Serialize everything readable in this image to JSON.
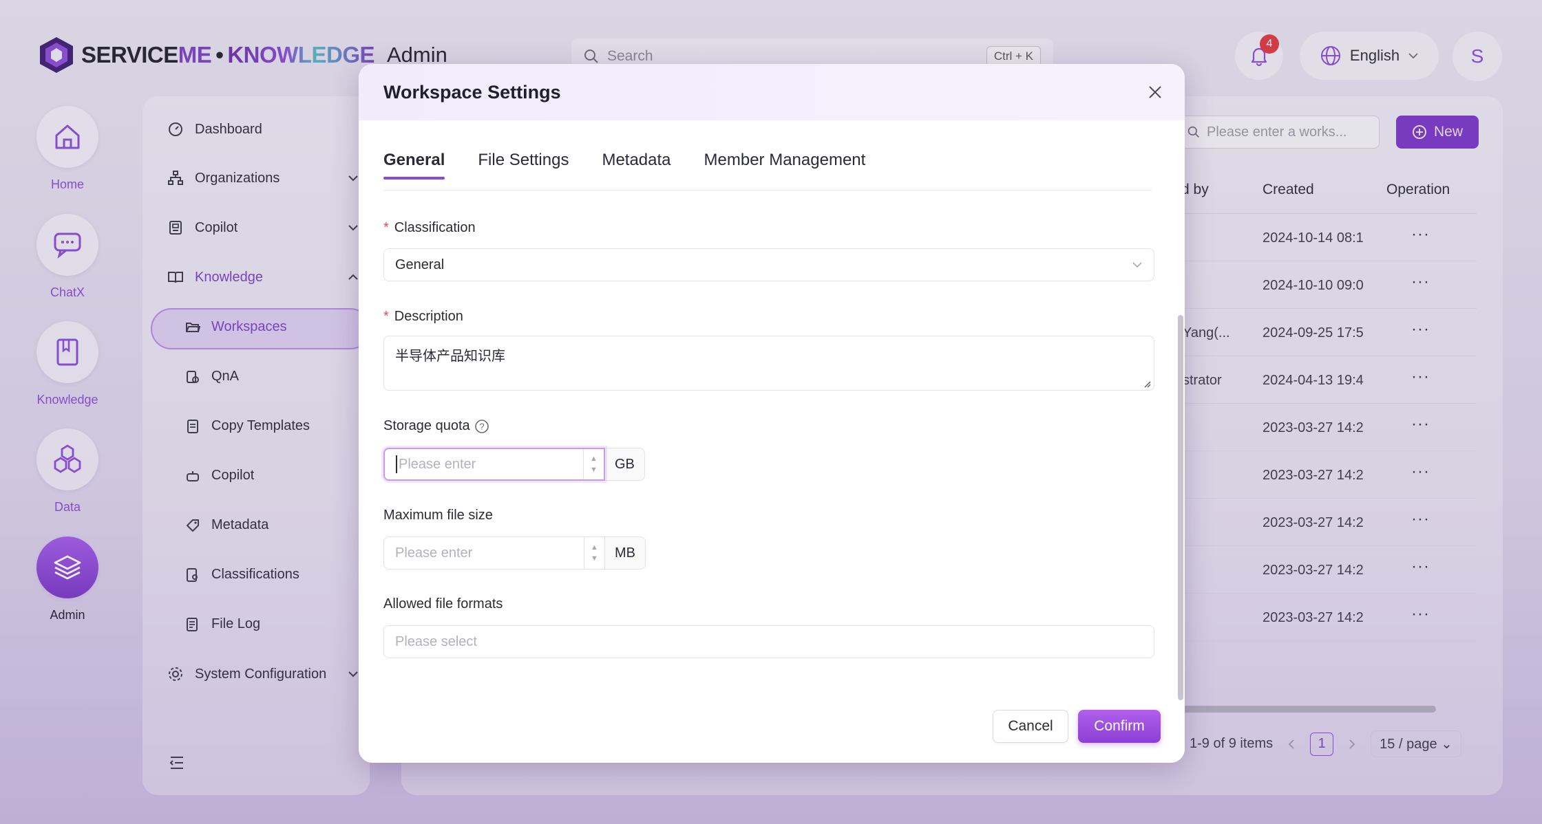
{
  "header": {
    "logo_brand_a": "SERVICE",
    "logo_brand_b": "ME",
    "logo_sep": "•",
    "logo_product": "KNOWLEDGE",
    "page_title": "Admin",
    "search_placeholder": "Search",
    "search_shortcut": "Ctrl + K",
    "notification_count": "4",
    "language": "English",
    "avatar_initial": "S"
  },
  "rail": [
    {
      "label": "Home",
      "icon": "home-icon"
    },
    {
      "label": "ChatX",
      "icon": "chat-icon"
    },
    {
      "label": "Knowledge",
      "icon": "book-icon"
    },
    {
      "label": "Data",
      "icon": "hexagons-icon"
    },
    {
      "label": "Admin",
      "icon": "layers-icon",
      "active": true
    }
  ],
  "nav": {
    "dashboard": "Dashboard",
    "organizations": "Organizations",
    "copilot": "Copilot",
    "knowledge": "Knowledge",
    "workspaces": "Workspaces",
    "qna": "QnA",
    "copy_templates": "Copy Templates",
    "copilot_sub": "Copilot",
    "metadata": "Metadata",
    "classifications": "Classifications",
    "file_log": "File Log",
    "system_configuration": "System Configuration"
  },
  "table": {
    "search_placeholder": "Please enter a works...",
    "new_label": "New",
    "col_by": "d by",
    "col_created": "Created",
    "col_operation": "Operation",
    "rows": [
      {
        "by": "",
        "created": "2024-10-14 08:1",
        "op": "···"
      },
      {
        "by": "",
        "created": "2024-10-10 09:0",
        "op": "···"
      },
      {
        "by": "Yang(...",
        "created": "2024-09-25 17:5",
        "op": "···"
      },
      {
        "by": "strator",
        "created": "2024-04-13 19:4",
        "op": "···"
      },
      {
        "by": "",
        "created": "2023-03-27 14:2",
        "op": "···"
      },
      {
        "by": "",
        "created": "2023-03-27 14:2",
        "op": "···"
      },
      {
        "by": "",
        "created": "2023-03-27 14:2",
        "op": "···"
      },
      {
        "by": "",
        "created": "2023-03-27 14:2",
        "op": "···"
      },
      {
        "by": "",
        "created": "2023-03-27 14:2",
        "op": "···"
      }
    ],
    "pager_summary": "1-9 of 9 items",
    "page": "1",
    "page_size": "15 / page"
  },
  "modal": {
    "title": "Workspace Settings",
    "tabs": [
      "General",
      "File Settings",
      "Metadata",
      "Member Management"
    ],
    "active_tab": "General",
    "classification_label": "Classification",
    "classification_value": "General",
    "description_label": "Description",
    "description_value": "半导体产品知识库",
    "storage_label": "Storage quota",
    "storage_placeholder": "Please enter",
    "storage_unit": "GB",
    "maxsize_label": "Maximum file size",
    "maxsize_placeholder": "Please enter",
    "maxsize_unit": "MB",
    "formats_label": "Allowed file formats",
    "formats_placeholder": "Please select",
    "required_mark": "*",
    "cancel_label": "Cancel",
    "confirm_label": "Confirm"
  },
  "colors": {
    "accent": "#8a4ad6",
    "accent_dark": "#7a35c6",
    "badge": "#e0383e",
    "required": "#e24d4d"
  }
}
